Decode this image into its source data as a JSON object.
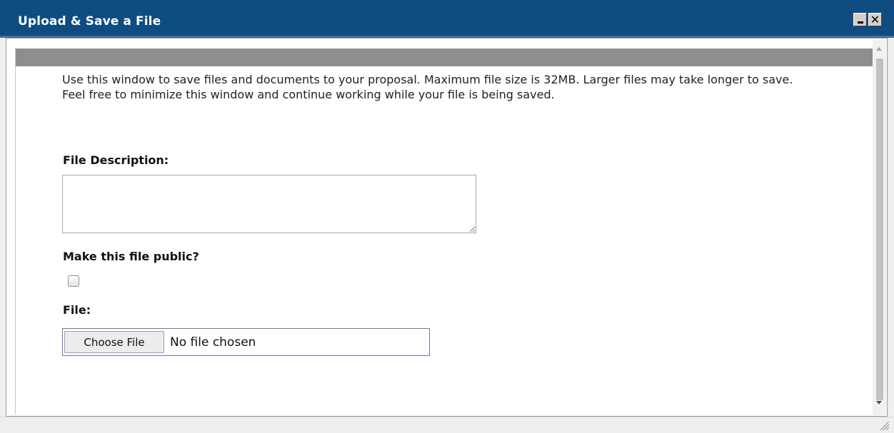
{
  "window": {
    "title": "Upload & Save a File",
    "controls": {
      "minimize_icon": "minimize-icon",
      "close_icon": "close-icon",
      "close_glyph": "✕"
    }
  },
  "form": {
    "intro": "Use this window to save files and documents to your proposal. Maximum file size is 32MB. Larger files may take longer to save. Feel free to minimize this window and continue working while your file is being saved.",
    "description_label": "File Description:",
    "description_value": "",
    "public_label": "Make this file public?",
    "public_checked": false,
    "file_label": "File:",
    "choose_button": "Choose File",
    "no_file_text": "No file chosen"
  },
  "colors": {
    "titlebar": "#0e4c82",
    "header_strip": "#8e8e8e"
  }
}
